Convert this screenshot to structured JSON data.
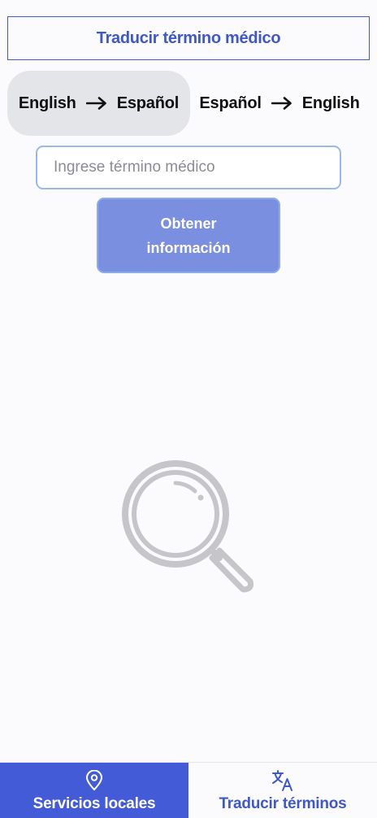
{
  "header": {
    "title": "Traducir término médico"
  },
  "direction_options": [
    {
      "from": "English",
      "to": "Español",
      "selected": true
    },
    {
      "from": "Español",
      "to": "English",
      "selected": false
    }
  ],
  "search": {
    "placeholder": "Ingrese término médico",
    "value": ""
  },
  "submit_button": {
    "label": "Obtener información"
  },
  "illustration": {
    "icon": "magnifying-glass-icon"
  },
  "bottom_nav": {
    "items": [
      {
        "label": "Servicios locales",
        "icon": "location-pin-icon",
        "active": true
      },
      {
        "label": "Traducir términos",
        "icon": "translate-icon",
        "active": false
      }
    ]
  },
  "colors": {
    "accent": "#435bd6",
    "button": "#7b8fe0",
    "selected_option_bg": "#e4e5e9",
    "background": "#fbfafd"
  }
}
